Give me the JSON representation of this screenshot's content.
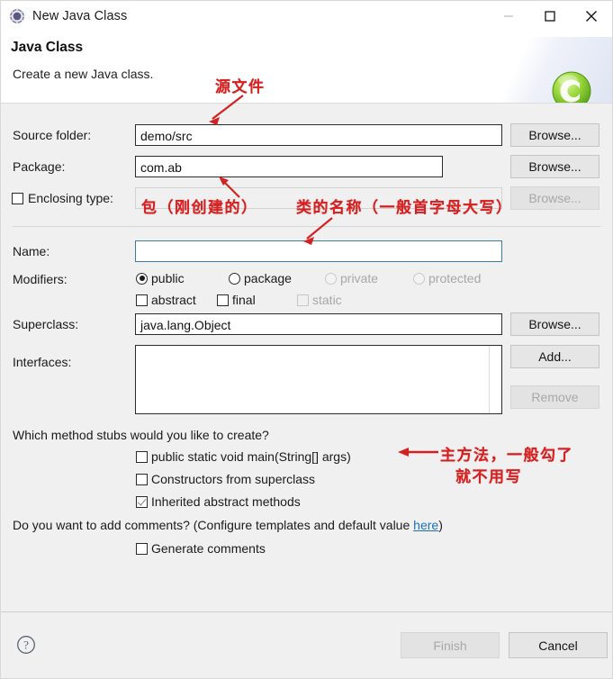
{
  "window": {
    "title": "New Java Class",
    "icon": "java-class-wizard-icon",
    "minimize": "minimize",
    "maximize": "maximize",
    "close": "close"
  },
  "header": {
    "title": "Java Class",
    "subtitle": "Create a new Java class.",
    "banner_icon": "green-class-badge-icon"
  },
  "form": {
    "source_folder": {
      "label": "Source folder:",
      "value": "demo/src",
      "browse": "Browse..."
    },
    "package": {
      "label": "Package:",
      "value": "com.ab",
      "browse": "Browse..."
    },
    "enclosing_type": {
      "label": "Enclosing type:",
      "value": "",
      "browse": "Browse...",
      "checked": false,
      "disabled": true
    },
    "name": {
      "label": "Name:",
      "value": "",
      "focused": true
    },
    "modifiers": {
      "label": "Modifiers:",
      "radios": [
        {
          "label": "public",
          "selected": true,
          "disabled": false
        },
        {
          "label": "package",
          "selected": false,
          "disabled": false
        },
        {
          "label": "private",
          "selected": false,
          "disabled": true
        },
        {
          "label": "protected",
          "selected": false,
          "disabled": true
        }
      ],
      "checkboxes": [
        {
          "label": "abstract",
          "checked": false,
          "disabled": false
        },
        {
          "label": "final",
          "checked": false,
          "disabled": false
        },
        {
          "label": "static",
          "checked": false,
          "disabled": true
        }
      ]
    },
    "superclass": {
      "label": "Superclass:",
      "value": "java.lang.Object",
      "browse": "Browse..."
    },
    "interfaces": {
      "label": "Interfaces:",
      "items": [],
      "add": "Add...",
      "remove": "Remove",
      "remove_disabled": true
    }
  },
  "stubs": {
    "question": "Which method stubs would you like to create?",
    "options": [
      {
        "label": "public static void main(String[] args)",
        "checked": false
      },
      {
        "label": "Constructors from superclass",
        "checked": false
      },
      {
        "label": "Inherited abstract methods",
        "checked": true
      }
    ]
  },
  "comments": {
    "question_prefix": "Do you want to add comments? (Configure templates and default value ",
    "link": "here",
    "question_suffix": ")",
    "option": {
      "label": "Generate comments",
      "checked": false
    }
  },
  "footer": {
    "help": "help-icon",
    "finish": "Finish",
    "finish_disabled": true,
    "cancel": "Cancel"
  },
  "annotations": [
    {
      "id": "source-file-note",
      "text": "源文件"
    },
    {
      "id": "package-note",
      "text": "包（刚创建的）"
    },
    {
      "id": "class-name-note",
      "text": "类的名称（一般首字母大写）"
    },
    {
      "id": "main-method-note-line1",
      "text": "主方法，一般勾了"
    },
    {
      "id": "main-method-note-line2",
      "text": "就不用写"
    }
  ],
  "colors": {
    "annotation": "#d42020",
    "link": "#1d6fb8",
    "focus_border": "#3c7d9c",
    "window_bg": "#f0f0f0"
  }
}
